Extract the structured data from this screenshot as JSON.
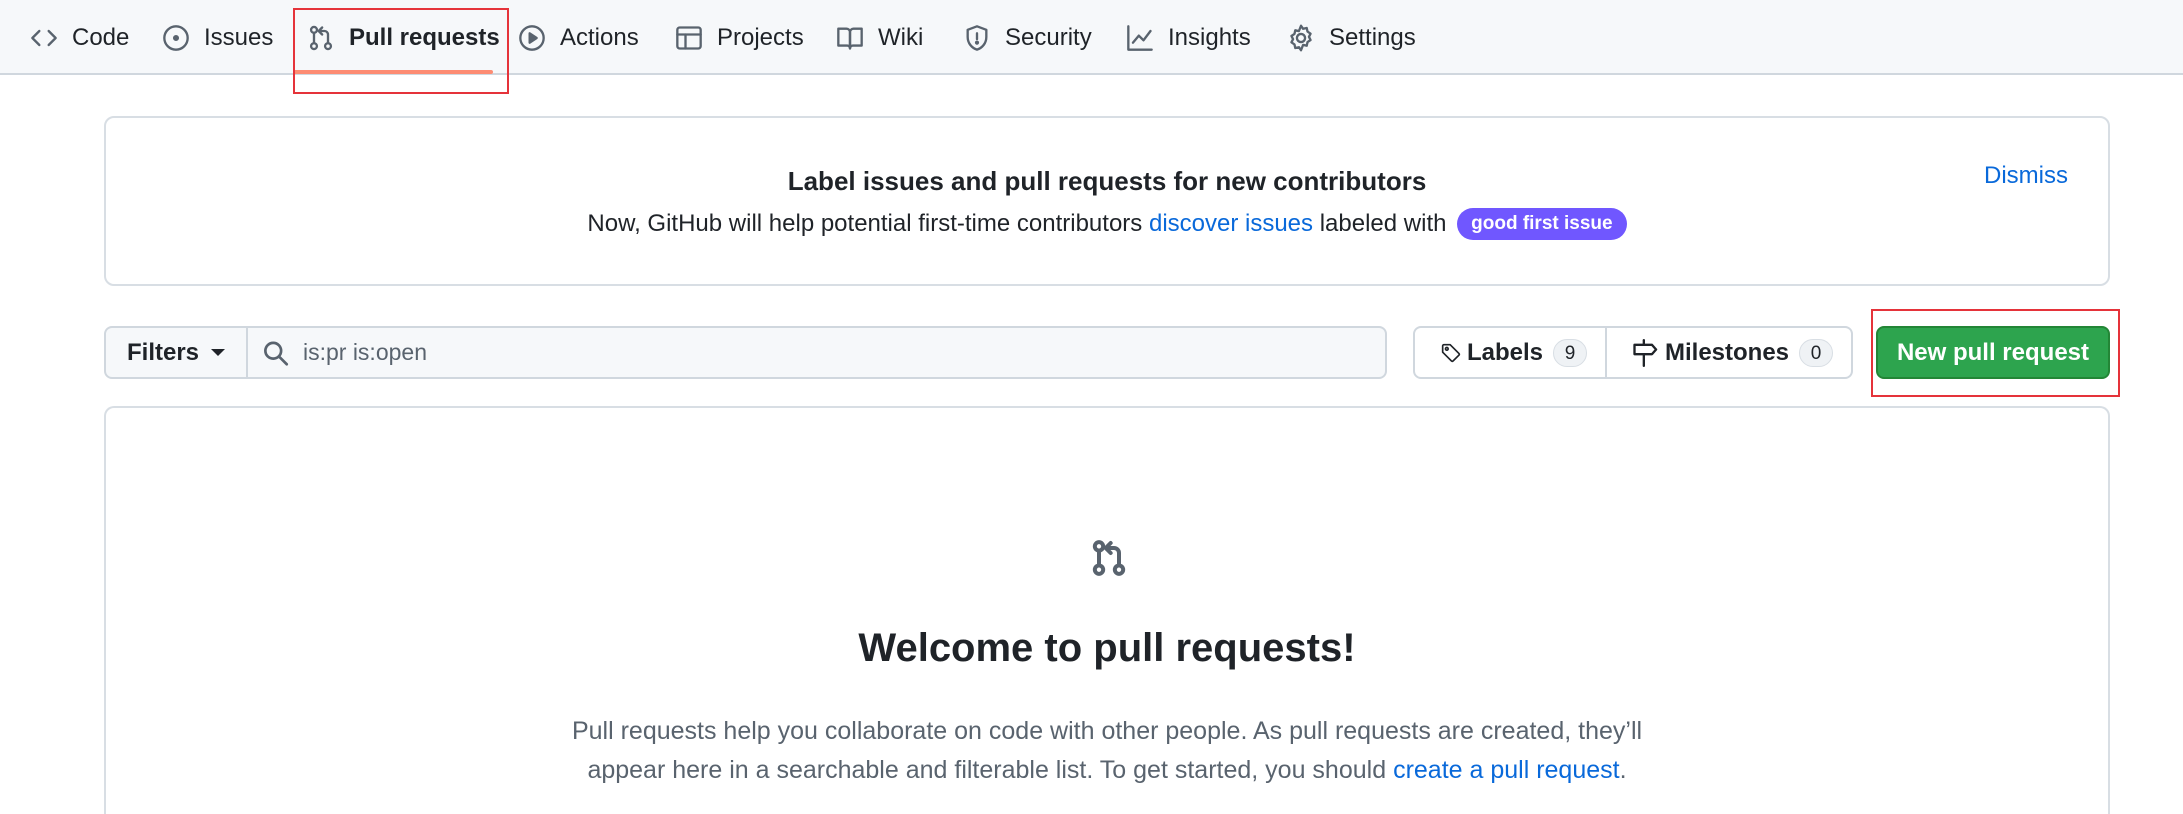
{
  "nav": {
    "tabs": [
      {
        "label": "Code",
        "icon": "code-icon"
      },
      {
        "label": "Issues",
        "icon": "issue-opened-icon"
      },
      {
        "label": "Pull requests",
        "icon": "git-pull-request-icon",
        "selected": true
      },
      {
        "label": "Actions",
        "icon": "play-icon"
      },
      {
        "label": "Projects",
        "icon": "table-icon"
      },
      {
        "label": "Wiki",
        "icon": "book-icon"
      },
      {
        "label": "Security",
        "icon": "shield-icon"
      },
      {
        "label": "Insights",
        "icon": "graph-icon"
      },
      {
        "label": "Settings",
        "icon": "gear-icon"
      }
    ],
    "selected_underline_color": "#fd8c73"
  },
  "banner": {
    "title": "Label issues and pull requests for new contributors",
    "text_before": "Now, GitHub will help potential first-time contributors",
    "link": "discover issues",
    "text_after": "labeled with",
    "label": "good first issue",
    "label_color": "#7057ff",
    "dismiss": "Dismiss"
  },
  "toolbar": {
    "filters_label": "Filters",
    "search_value": "is:pr is:open",
    "labels_label": "Labels",
    "labels_count": "9",
    "milestones_label": "Milestones",
    "milestones_count": "0",
    "new_pr_label": "New pull request",
    "new_pr_color": "#2da44e"
  },
  "blankslate": {
    "icon": "git-pull-request-icon",
    "title": "Welcome to pull requests!",
    "line1": "Pull requests help you collaborate on code with other people. As pull requests are created, they’ll",
    "line2_before": "appear here in a searchable and filterable list. To get started, you should",
    "line2_link": "create a pull request",
    "line2_after": "."
  },
  "highlight_color": "#e5333a"
}
